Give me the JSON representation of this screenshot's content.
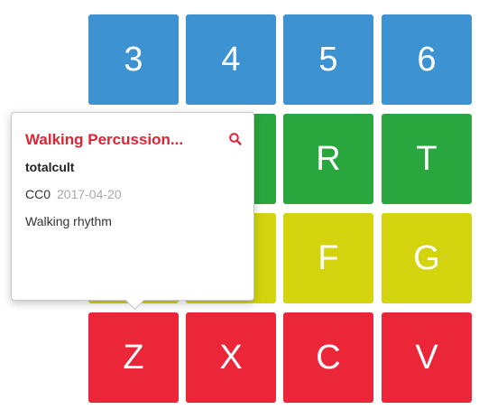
{
  "pads": {
    "row1": [
      "3",
      "4",
      "5",
      "6"
    ],
    "row2": [
      "R",
      "T"
    ],
    "row3": [
      "F",
      "G"
    ],
    "row4": [
      "Z",
      "X",
      "C",
      "V"
    ]
  },
  "colors": {
    "blue": "#3d92d2",
    "green": "#2aa63f",
    "yellow": "#d3d40e",
    "red": "#eb2638",
    "title_red": "#e12336"
  },
  "popover": {
    "title": "Walking Percussion...",
    "author": "totalcult",
    "license": "CC0",
    "date": "2017-04-20",
    "description": "Walking rhythm",
    "search_icon": "search-icon"
  }
}
